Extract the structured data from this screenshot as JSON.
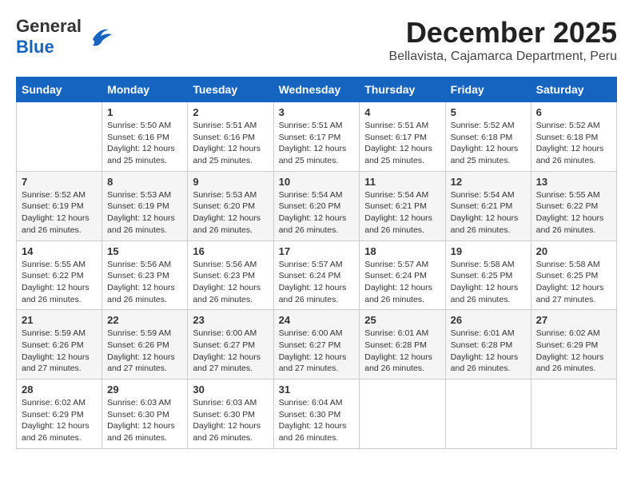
{
  "logo": {
    "line1": "General",
    "line2": "Blue",
    "bird_unicode": "🐦"
  },
  "title": "December 2025",
  "subtitle": "Bellavista, Cajamarca Department, Peru",
  "weekdays": [
    "Sunday",
    "Monday",
    "Tuesday",
    "Wednesday",
    "Thursday",
    "Friday",
    "Saturday"
  ],
  "weeks": [
    [
      {
        "day": "",
        "info": ""
      },
      {
        "day": "1",
        "info": "Sunrise: 5:50 AM\nSunset: 6:16 PM\nDaylight: 12 hours\nand 25 minutes."
      },
      {
        "day": "2",
        "info": "Sunrise: 5:51 AM\nSunset: 6:16 PM\nDaylight: 12 hours\nand 25 minutes."
      },
      {
        "day": "3",
        "info": "Sunrise: 5:51 AM\nSunset: 6:17 PM\nDaylight: 12 hours\nand 25 minutes."
      },
      {
        "day": "4",
        "info": "Sunrise: 5:51 AM\nSunset: 6:17 PM\nDaylight: 12 hours\nand 25 minutes."
      },
      {
        "day": "5",
        "info": "Sunrise: 5:52 AM\nSunset: 6:18 PM\nDaylight: 12 hours\nand 25 minutes."
      },
      {
        "day": "6",
        "info": "Sunrise: 5:52 AM\nSunset: 6:18 PM\nDaylight: 12 hours\nand 26 minutes."
      }
    ],
    [
      {
        "day": "7",
        "info": "Sunrise: 5:52 AM\nSunset: 6:19 PM\nDaylight: 12 hours\nand 26 minutes."
      },
      {
        "day": "8",
        "info": "Sunrise: 5:53 AM\nSunset: 6:19 PM\nDaylight: 12 hours\nand 26 minutes."
      },
      {
        "day": "9",
        "info": "Sunrise: 5:53 AM\nSunset: 6:20 PM\nDaylight: 12 hours\nand 26 minutes."
      },
      {
        "day": "10",
        "info": "Sunrise: 5:54 AM\nSunset: 6:20 PM\nDaylight: 12 hours\nand 26 minutes."
      },
      {
        "day": "11",
        "info": "Sunrise: 5:54 AM\nSunset: 6:21 PM\nDaylight: 12 hours\nand 26 minutes."
      },
      {
        "day": "12",
        "info": "Sunrise: 5:54 AM\nSunset: 6:21 PM\nDaylight: 12 hours\nand 26 minutes."
      },
      {
        "day": "13",
        "info": "Sunrise: 5:55 AM\nSunset: 6:22 PM\nDaylight: 12 hours\nand 26 minutes."
      }
    ],
    [
      {
        "day": "14",
        "info": "Sunrise: 5:55 AM\nSunset: 6:22 PM\nDaylight: 12 hours\nand 26 minutes."
      },
      {
        "day": "15",
        "info": "Sunrise: 5:56 AM\nSunset: 6:23 PM\nDaylight: 12 hours\nand 26 minutes."
      },
      {
        "day": "16",
        "info": "Sunrise: 5:56 AM\nSunset: 6:23 PM\nDaylight: 12 hours\nand 26 minutes."
      },
      {
        "day": "17",
        "info": "Sunrise: 5:57 AM\nSunset: 6:24 PM\nDaylight: 12 hours\nand 26 minutes."
      },
      {
        "day": "18",
        "info": "Sunrise: 5:57 AM\nSunset: 6:24 PM\nDaylight: 12 hours\nand 26 minutes."
      },
      {
        "day": "19",
        "info": "Sunrise: 5:58 AM\nSunset: 6:25 PM\nDaylight: 12 hours\nand 26 minutes."
      },
      {
        "day": "20",
        "info": "Sunrise: 5:58 AM\nSunset: 6:25 PM\nDaylight: 12 hours\nand 27 minutes."
      }
    ],
    [
      {
        "day": "21",
        "info": "Sunrise: 5:59 AM\nSunset: 6:26 PM\nDaylight: 12 hours\nand 27 minutes."
      },
      {
        "day": "22",
        "info": "Sunrise: 5:59 AM\nSunset: 6:26 PM\nDaylight: 12 hours\nand 27 minutes."
      },
      {
        "day": "23",
        "info": "Sunrise: 6:00 AM\nSunset: 6:27 PM\nDaylight: 12 hours\nand 27 minutes."
      },
      {
        "day": "24",
        "info": "Sunrise: 6:00 AM\nSunset: 6:27 PM\nDaylight: 12 hours\nand 27 minutes."
      },
      {
        "day": "25",
        "info": "Sunrise: 6:01 AM\nSunset: 6:28 PM\nDaylight: 12 hours\nand 26 minutes."
      },
      {
        "day": "26",
        "info": "Sunrise: 6:01 AM\nSunset: 6:28 PM\nDaylight: 12 hours\nand 26 minutes."
      },
      {
        "day": "27",
        "info": "Sunrise: 6:02 AM\nSunset: 6:29 PM\nDaylight: 12 hours\nand 26 minutes."
      }
    ],
    [
      {
        "day": "28",
        "info": "Sunrise: 6:02 AM\nSunset: 6:29 PM\nDaylight: 12 hours\nand 26 minutes."
      },
      {
        "day": "29",
        "info": "Sunrise: 6:03 AM\nSunset: 6:30 PM\nDaylight: 12 hours\nand 26 minutes."
      },
      {
        "day": "30",
        "info": "Sunrise: 6:03 AM\nSunset: 6:30 PM\nDaylight: 12 hours\nand 26 minutes."
      },
      {
        "day": "31",
        "info": "Sunrise: 6:04 AM\nSunset: 6:30 PM\nDaylight: 12 hours\nand 26 minutes."
      },
      {
        "day": "",
        "info": ""
      },
      {
        "day": "",
        "info": ""
      },
      {
        "day": "",
        "info": ""
      }
    ]
  ]
}
